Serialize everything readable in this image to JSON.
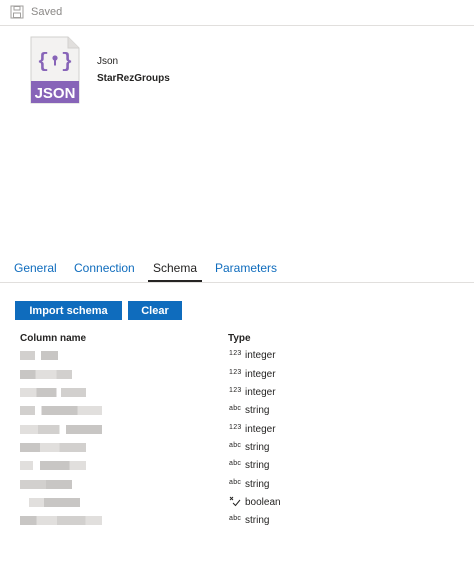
{
  "header": {
    "saved_label": "Saved"
  },
  "dataset": {
    "badge": "JSON",
    "type_label": "Json",
    "name": "StarRezGroups"
  },
  "tabs": [
    {
      "label": "General",
      "active": false
    },
    {
      "label": "Connection",
      "active": false
    },
    {
      "label": "Schema",
      "active": true
    },
    {
      "label": "Parameters",
      "active": false
    }
  ],
  "schema": {
    "import_label": "Import schema",
    "clear_label": "Clear",
    "column_header": "Column name",
    "type_header": "Type",
    "rows": [
      {
        "type_icon": "123",
        "type": "integer"
      },
      {
        "type_icon": "123",
        "type": "integer"
      },
      {
        "type_icon": "123",
        "type": "integer"
      },
      {
        "type_icon": "abc",
        "type": "string"
      },
      {
        "type_icon": "123",
        "type": "integer"
      },
      {
        "type_icon": "abc",
        "type": "string"
      },
      {
        "type_icon": "abc",
        "type": "string"
      },
      {
        "type_icon": "abc",
        "type": "string"
      },
      {
        "type_icon": "boolean-icon",
        "type": "boolean"
      },
      {
        "type_icon": "abc",
        "type": "string"
      }
    ]
  },
  "colors": {
    "accent": "#0f6cbd",
    "json_badge": "#8764b8",
    "text": "#252423",
    "muted": "#8a8886"
  }
}
